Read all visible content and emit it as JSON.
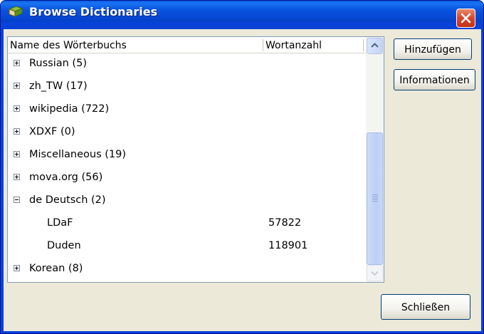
{
  "window": {
    "title": "Browse Dictionaries",
    "app_icon": "dictionary-book-icon",
    "close_icon": "close-icon"
  },
  "list": {
    "columns": [
      "Name des Wörterbuchs",
      "Wortanzahl"
    ],
    "rows": [
      {
        "name": "Russian (5)",
        "count": "",
        "level": 0,
        "expander": "plus"
      },
      {
        "name": "zh_TW (17)",
        "count": "",
        "level": 0,
        "expander": "plus"
      },
      {
        "name": "wikipedia (722)",
        "count": "",
        "level": 0,
        "expander": "plus"
      },
      {
        "name": "XDXF (0)",
        "count": "",
        "level": 0,
        "expander": "plus"
      },
      {
        "name": "Miscellaneous (19)",
        "count": "",
        "level": 0,
        "expander": "plus"
      },
      {
        "name": "mova.org (56)",
        "count": "",
        "level": 0,
        "expander": "plus"
      },
      {
        "name": "de Deutsch (2)",
        "count": "",
        "level": 0,
        "expander": "minus"
      },
      {
        "name": "LDaF",
        "count": "57822",
        "level": 1,
        "expander": "none"
      },
      {
        "name": "Duden",
        "count": "118901",
        "level": 1,
        "expander": "none"
      },
      {
        "name": "Korean (8)",
        "count": "",
        "level": 0,
        "expander": "plus"
      }
    ]
  },
  "buttons": {
    "add": "Hinzufügen",
    "info": "Informationen",
    "close": "Schließen"
  },
  "scrollbar": {
    "up_icon": "scroll-up-arrow-icon",
    "down_icon": "scroll-down-arrow-icon"
  }
}
